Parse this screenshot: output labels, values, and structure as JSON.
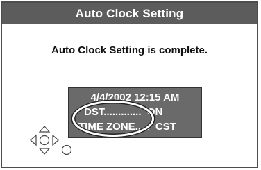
{
  "dialog": {
    "title": "Auto Clock Setting",
    "message": "Auto Clock Setting is complete."
  },
  "info": {
    "date_time": "4/4/2002 12:15 AM",
    "dst_line": "DST.............  ON",
    "timezone_line": "TIME ZONE.....  CST"
  },
  "icons": {
    "remote": "directional-pad-icon",
    "enter": "enter-button-icon"
  },
  "colors": {
    "title_bar": "#5c5c5c",
    "info_box": "#6a6a6a",
    "highlight": "#ffffff"
  }
}
